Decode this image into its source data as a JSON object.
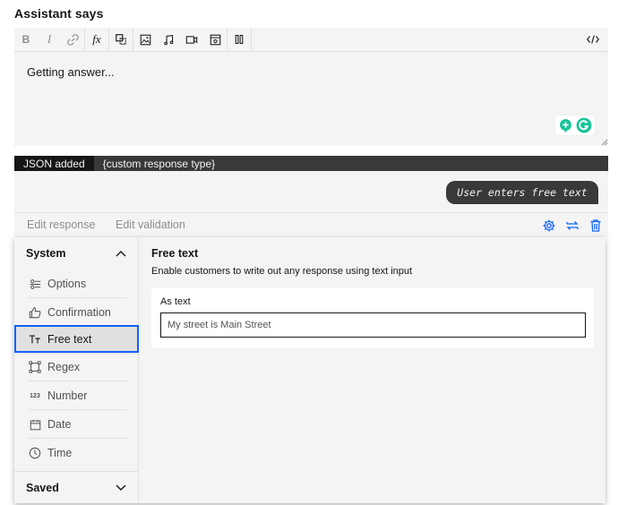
{
  "heading": "Assistant says",
  "toolbar": {
    "bold": "B",
    "italic": "I",
    "function": "fx"
  },
  "editor": {
    "text": "Getting answer..."
  },
  "json_bar": {
    "tag": "JSON added",
    "text": "{custom response type}"
  },
  "preview": {
    "bubble": "User enters free text"
  },
  "tabs": {
    "edit_response": "Edit response",
    "edit_validation": "Edit validation"
  },
  "panel": {
    "system_label": "System",
    "saved_label": "Saved",
    "items": [
      {
        "label": "Options",
        "icon": "options-icon"
      },
      {
        "label": "Confirmation",
        "icon": "thumbs-up-icon"
      },
      {
        "label": "Free text",
        "icon": "text-icon"
      },
      {
        "label": "Regex",
        "icon": "regex-icon"
      },
      {
        "label": "Number",
        "icon": "number-icon"
      },
      {
        "label": "Date",
        "icon": "calendar-icon"
      },
      {
        "label": "Time",
        "icon": "clock-icon"
      }
    ],
    "selected": "Free text",
    "content_title": "Free text",
    "content_desc": "Enable customers to write out any response using text input",
    "card_label": "As text",
    "number_glyph": "123",
    "input_value": "My street is Main Street"
  },
  "colors": {
    "accent": "#0f62fe",
    "dark": "#161616",
    "panel_bg": "#f4f4f4",
    "grammarly_green": "#15c39a"
  }
}
